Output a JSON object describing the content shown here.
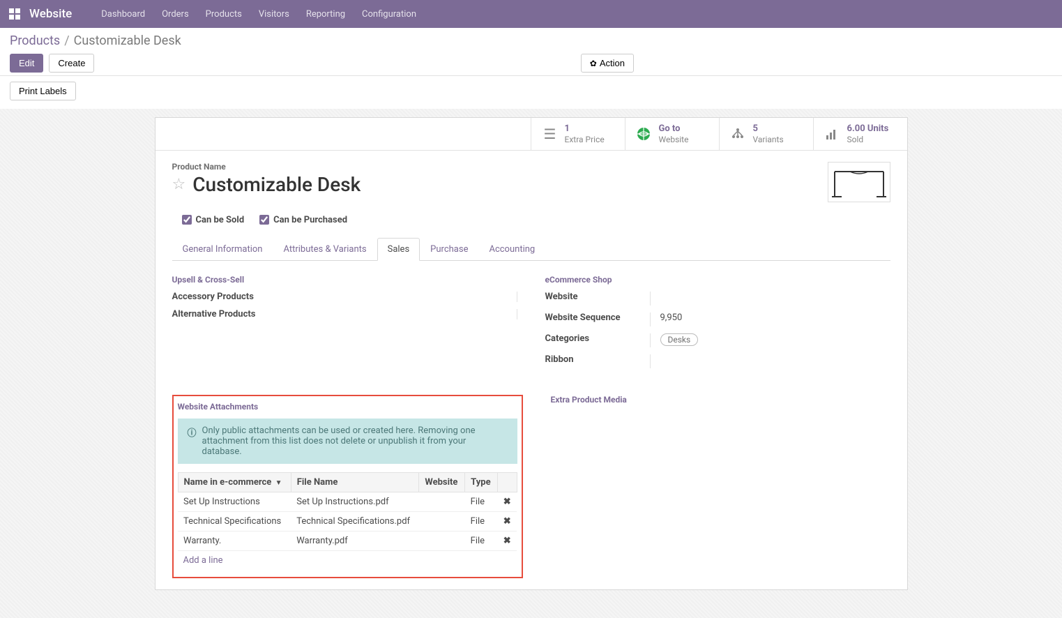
{
  "nav": {
    "brand": "Website",
    "items": [
      "Dashboard",
      "Orders",
      "Products",
      "Visitors",
      "Reporting",
      "Configuration"
    ]
  },
  "breadcrumb": {
    "root": "Products",
    "current": "Customizable Desk"
  },
  "buttons": {
    "edit": "Edit",
    "create": "Create",
    "action": "Action",
    "print_labels": "Print Labels"
  },
  "stats": {
    "extra_price": {
      "value": "1",
      "label": "Extra Price"
    },
    "goto_website": {
      "value": "Go to",
      "label": "Website"
    },
    "variants": {
      "value": "5",
      "label": "Variants"
    },
    "sold": {
      "value": "6.00 Units",
      "label": "Sold"
    }
  },
  "product": {
    "name_label": "Product Name",
    "name": "Customizable Desk",
    "can_be_sold": "Can be Sold",
    "can_be_purchased": "Can be Purchased"
  },
  "tabs": [
    "General Information",
    "Attributes & Variants",
    "Sales",
    "Purchase",
    "Accounting"
  ],
  "upsell": {
    "title": "Upsell & Cross-Sell",
    "accessory": "Accessory Products",
    "alternative": "Alternative Products"
  },
  "ecommerce": {
    "title": "eCommerce Shop",
    "website": {
      "label": "Website",
      "value": ""
    },
    "sequence": {
      "label": "Website Sequence",
      "value": "9,950"
    },
    "categories": {
      "label": "Categories",
      "value": "Desks"
    },
    "ribbon": {
      "label": "Ribbon",
      "value": ""
    }
  },
  "attachments": {
    "title": "Website Attachments",
    "info": "Only public attachments can be used or created here. Removing one attachment from this list does not delete or unpublish it from your database.",
    "headers": {
      "name": "Name in e-commerce",
      "file": "File Name",
      "website": "Website",
      "type": "Type"
    },
    "rows": [
      {
        "name": "Set Up Instructions",
        "file": "Set Up Instructions.pdf",
        "website": "",
        "type": "File"
      },
      {
        "name": "Technical Specifications",
        "file": "Technical Specifications.pdf",
        "website": "",
        "type": "File"
      },
      {
        "name": "Warranty.",
        "file": "Warranty.pdf",
        "website": "",
        "type": "File"
      }
    ],
    "add_line": "Add a line"
  },
  "extra_media": {
    "title": "Extra Product Media"
  }
}
